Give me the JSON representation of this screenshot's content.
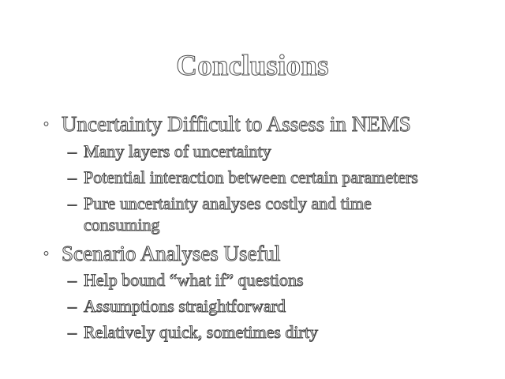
{
  "slide": {
    "title": "Conclusions",
    "bullets": [
      {
        "marker": "•",
        "text": "Uncertainty Difficult to Assess in NEMS",
        "subitems": [
          {
            "marker": "–",
            "text": "Many layers of uncertainty"
          },
          {
            "marker": "–",
            "text": "Potential interaction between certain parameters"
          },
          {
            "marker": "–",
            "text": "Pure uncertainty analyses costly and time",
            "continuation": "consuming"
          }
        ]
      },
      {
        "marker": "•",
        "text": "Scenario Analyses Useful",
        "subitems": [
          {
            "marker": "–",
            "text": "Help bound “what if” questions"
          },
          {
            "marker": "–",
            "text": "Assumptions straightforward"
          },
          {
            "marker": "–",
            "text": "Relatively quick, sometimes dirty"
          }
        ]
      }
    ]
  }
}
